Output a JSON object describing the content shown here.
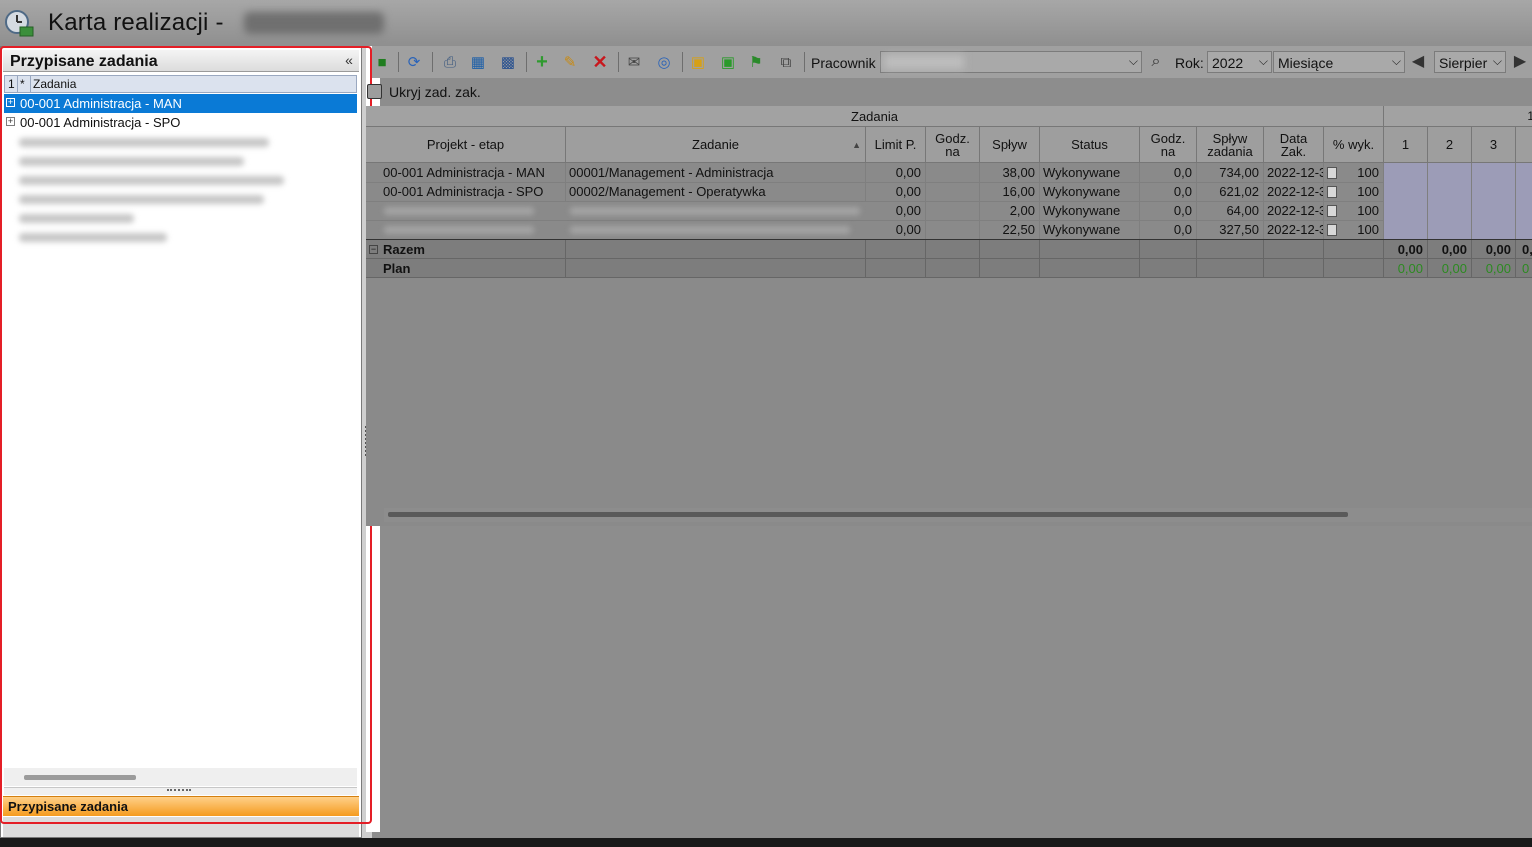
{
  "window": {
    "title": "Karta realizacji -"
  },
  "left_panel": {
    "title": "Przypisane zadania",
    "collapse_symbol": "«",
    "grid_header": {
      "col1": "1",
      "col2": "*",
      "col3": "Zadania"
    },
    "items": [
      {
        "label": "00-001 Administracja - MAN",
        "selected": true
      },
      {
        "label": "00-001 Administracja - SPO",
        "selected": false
      }
    ],
    "bottom_tab": "Przypisane zadania"
  },
  "toolbar": {
    "employee_label": "Pracownik",
    "year_label": "Rok:",
    "year_value": "2022",
    "period_value": "Miesiące",
    "month_value": "Sierpier",
    "icons": [
      "save-icon",
      "refresh-icon",
      "print-icon",
      "excel-icon",
      "grid-check-icon",
      "add-icon",
      "edit-icon",
      "delete-icon",
      "mail-icon",
      "approve-icon",
      "yellow-check-icon",
      "green-check-icon",
      "flag-icon",
      "preview-icon",
      "search-icon",
      "arrow-left-icon",
      "arrow-right-icon"
    ]
  },
  "options": {
    "hide_completed_label": "Ukryj zad. zak."
  },
  "grid": {
    "group_header": "Zadania",
    "group_header2": "1",
    "columns": {
      "projekt": "Projekt - etap",
      "zadanie": "Zadanie",
      "limit": "Limit P.",
      "godz_na": "Godz.\nna",
      "splyw": "Spływ",
      "status": "Status",
      "godz_na2": "Godz.\nna",
      "splyw_zadania": "Spływ\nzadania",
      "data_zak": "Data\nZak.",
      "pct": "% wyk.",
      "d1": "1",
      "d2": "2",
      "d3": "3"
    },
    "rows": [
      {
        "projekt": "00-001 Administracja - MAN",
        "zadanie": "00001/Management - Administracja",
        "limit": "0,00",
        "godz": "",
        "splyw": "38,00",
        "status": "Wykonywane",
        "godz2": "0,0",
        "splyw_z": "734,00",
        "data": "2022-12-3",
        "pct": "100"
      },
      {
        "projekt": "00-001 Administracja - SPO",
        "zadanie": "00002/Management - Operatywka",
        "limit": "0,00",
        "godz": "",
        "splyw": "16,00",
        "status": "Wykonywane",
        "godz2": "0,0",
        "splyw_z": "621,02",
        "data": "2022-12-3",
        "pct": "100"
      },
      {
        "projekt": "",
        "zadanie": "",
        "limit": "0,00",
        "godz": "",
        "splyw": "2,00",
        "status": "Wykonywane",
        "godz2": "0,0",
        "splyw_z": "64,00",
        "data": "2022-12-3",
        "pct": "100"
      },
      {
        "projekt": "",
        "zadanie": "",
        "limit": "0,00",
        "godz": "",
        "splyw": "22,50",
        "status": "Wykonywane",
        "godz2": "0,0",
        "splyw_z": "327,50",
        "data": "2022-12-3",
        "pct": "100"
      }
    ],
    "summary": {
      "razem_label": "Razem",
      "plan_label": "Plan",
      "razem_values": [
        "0,00",
        "0,00",
        "0,00",
        "0,"
      ],
      "plan_values": [
        "0,00",
        "0,00",
        "0,00",
        "0"
      ]
    }
  },
  "colors": {
    "selection": "#0a7ad6",
    "tab_orange": "#f59b1f",
    "highlight_outline": "#e41e26",
    "plan_green": "#2c8a21"
  }
}
